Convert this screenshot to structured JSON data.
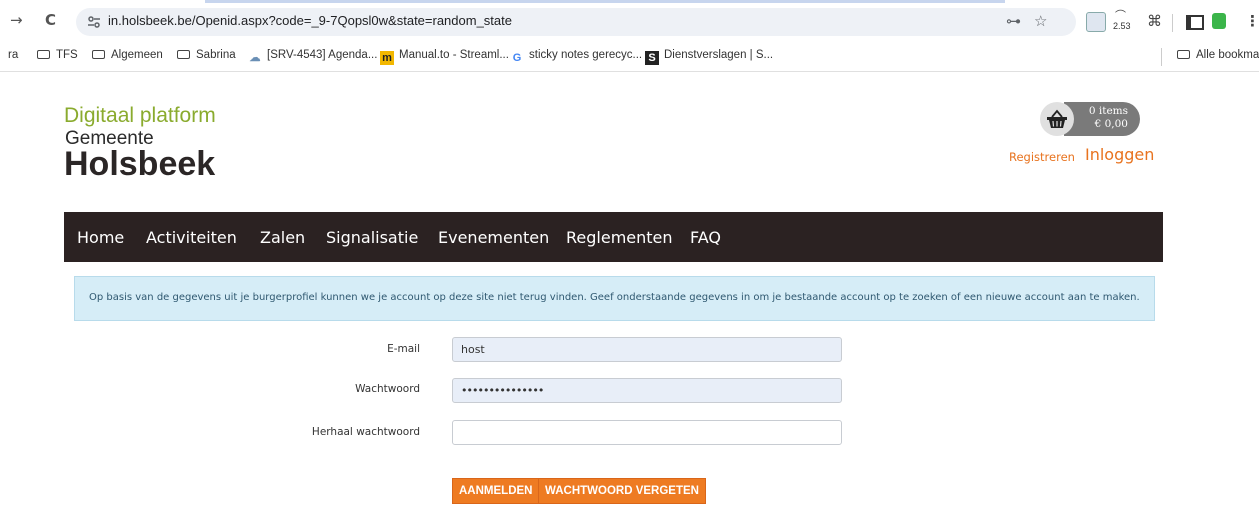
{
  "browser": {
    "back_glyph": "→",
    "reload_glyph": "C",
    "url": "in.holsbeek.be/Openid.aspx?code=_9-7Qopsl0w&state=random_state",
    "ext_badge": "2.53",
    "bookmarks": [
      {
        "label": "ra",
        "icon": "none"
      },
      {
        "label": "TFS",
        "icon": "folder-icon"
      },
      {
        "label": "Algemeen",
        "icon": "folder-icon"
      },
      {
        "label": "Sabrina",
        "icon": "folder-icon"
      },
      {
        "label": "[SRV-4543] Agenda...",
        "icon": "cloud-icon"
      },
      {
        "label": "Manual.to - Streaml...",
        "icon": "m-logo-icon"
      },
      {
        "label": "sticky notes gerecyc...",
        "icon": "google-icon"
      },
      {
        "label": "Dienstverslagen | S...",
        "icon": "s-logo-icon"
      }
    ],
    "all_bookmarks": "Alle bookmarks"
  },
  "logo": {
    "line1": "Digitaal platform",
    "line2": "Gemeente",
    "line3": "Holsbeek"
  },
  "cart": {
    "items": "0 items",
    "amount": "€ 0,00"
  },
  "auth": {
    "register": "Registreren",
    "login": "Inloggen"
  },
  "nav": [
    "Home",
    "Activiteiten",
    "Zalen",
    "Signalisatie",
    "Evenementen",
    "Reglementen",
    "FAQ"
  ],
  "info": "Op basis van de gegevens uit je burgerprofiel kunnen we je account op deze site niet terug vinden. Geef onderstaande gegevens in om je bestaande account op te zoeken of een nieuwe account aan te maken.",
  "form": {
    "email_label": "E-mail",
    "email_value": "host",
    "password_label": "Wachtwoord",
    "password_value": "•••••••••••••••",
    "repeat_label": "Herhaal wachtwoord",
    "repeat_value": ""
  },
  "buttons": {
    "register": "AANMELDEN",
    "forgot": "WACHTWOORD VERGETEN"
  },
  "colors": {
    "accent_orange": "#ee7b22",
    "nav_bg": "#2b2222",
    "logo_green": "#8aab2e",
    "info_bg": "#d6edf7"
  }
}
